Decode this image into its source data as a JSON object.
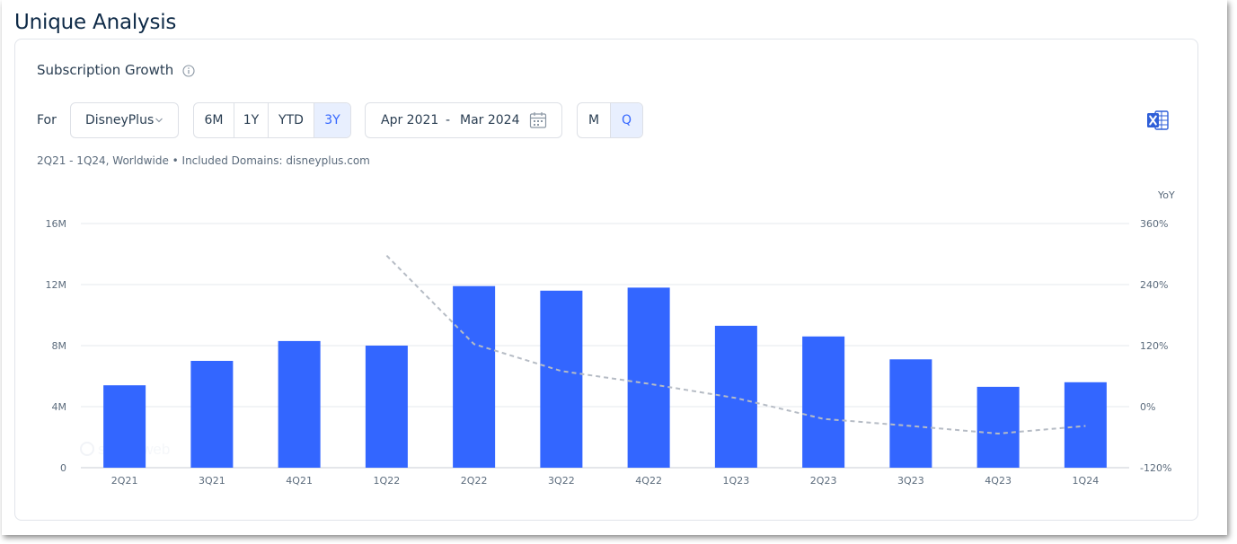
{
  "page": {
    "title": "Unique Analysis"
  },
  "card": {
    "title": "Subscription Growth",
    "info_icon": "info-icon"
  },
  "controls": {
    "for_label": "For",
    "dropdown_value": "DisneyPlus",
    "ranges": [
      {
        "label": "6M",
        "active": false
      },
      {
        "label": "1Y",
        "active": false
      },
      {
        "label": "YTD",
        "active": false
      },
      {
        "label": "3Y",
        "active": true
      }
    ],
    "date_from": "Apr 2021",
    "date_sep": "-",
    "date_to": "Mar 2024",
    "calendar_icon": "calendar-icon",
    "granularity": [
      {
        "label": "M",
        "active": false
      },
      {
        "label": "Q",
        "active": true
      }
    ],
    "export_icon": "excel-icon"
  },
  "subtitle": "2Q21 - 1Q24, Worldwide • Included Domains: disneyplus.com",
  "colors": {
    "bar": "#3366ff",
    "line": "#b6bcc5",
    "active_bg": "#e8effe",
    "active_text": "#3366ff"
  },
  "chart_data": {
    "type": "bar",
    "categories": [
      "2Q21",
      "3Q21",
      "4Q21",
      "1Q22",
      "2Q22",
      "3Q22",
      "4Q22",
      "1Q23",
      "2Q23",
      "3Q23",
      "4Q23",
      "1Q24"
    ],
    "series": [
      {
        "values": [
          5.4,
          7.0,
          8.3,
          8.0,
          11.9,
          11.6,
          11.8,
          9.3,
          8.6,
          7.1,
          5.3,
          5.6
        ]
      },
      {
        "axis": "right",
        "type": "line",
        "style": "dashed",
        "values": [
          null,
          null,
          null,
          297,
          123,
          70,
          45,
          17,
          -24,
          -38,
          -53,
          -38
        ]
      }
    ],
    "yaxis_left": {
      "ticks": [
        "0",
        "4M",
        "8M",
        "12M",
        "16M"
      ],
      "range": [
        0,
        16
      ]
    },
    "yaxis_right": {
      "label": "YoY",
      "ticks": [
        "-120%",
        "0%",
        "120%",
        "240%",
        "360%"
      ],
      "range": [
        -120,
        360
      ]
    },
    "grid": true,
    "legend": false
  }
}
